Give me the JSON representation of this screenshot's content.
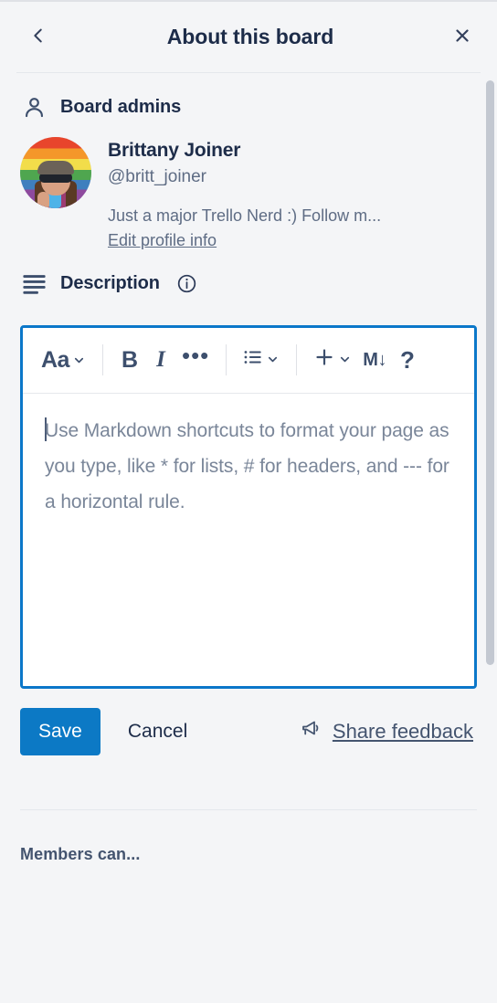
{
  "header": {
    "back_icon": "chevron-left-icon",
    "title": "About this board",
    "close_icon": "close-icon"
  },
  "admins_section": {
    "icon": "person-icon",
    "title": "Board admins",
    "admin": {
      "avatar_alt": "Brittany Joiner avatar",
      "name": "Brittany Joiner",
      "handle": "@britt_joiner",
      "bio": "Just a major Trello Nerd :) Follow m...",
      "edit_link": "Edit profile info"
    }
  },
  "description_section": {
    "icon": "description-lines-icon",
    "title": "Description",
    "info_icon": "info-circle-icon",
    "toolbar": {
      "text_style": "Aa",
      "text_style_chevron": "⌄",
      "bold": "B",
      "italic": "I",
      "more": "•••",
      "list": "list-icon",
      "list_chevron": "⌄",
      "insert": "+",
      "insert_chevron": "⌄",
      "markdown": "M↓",
      "help": "?"
    },
    "editor": {
      "value": "",
      "placeholder": "Use Markdown shortcuts to format your page as you type, like * for lists, # for headers, and --- for a horizontal rule."
    },
    "actions": {
      "save_label": "Save",
      "cancel_label": "Cancel",
      "feedback_icon": "megaphone-icon",
      "feedback_label": "Share feedback"
    }
  },
  "footer": {
    "members_label": "Members can..."
  },
  "colors": {
    "accent_blue": "#0c79c5",
    "focus_border": "#0b77c9",
    "panel_bg": "#f4f5f7",
    "text_dark": "#1d2c49",
    "text_muted": "#5e6c84",
    "scrollbar": "#c3c8d1"
  }
}
